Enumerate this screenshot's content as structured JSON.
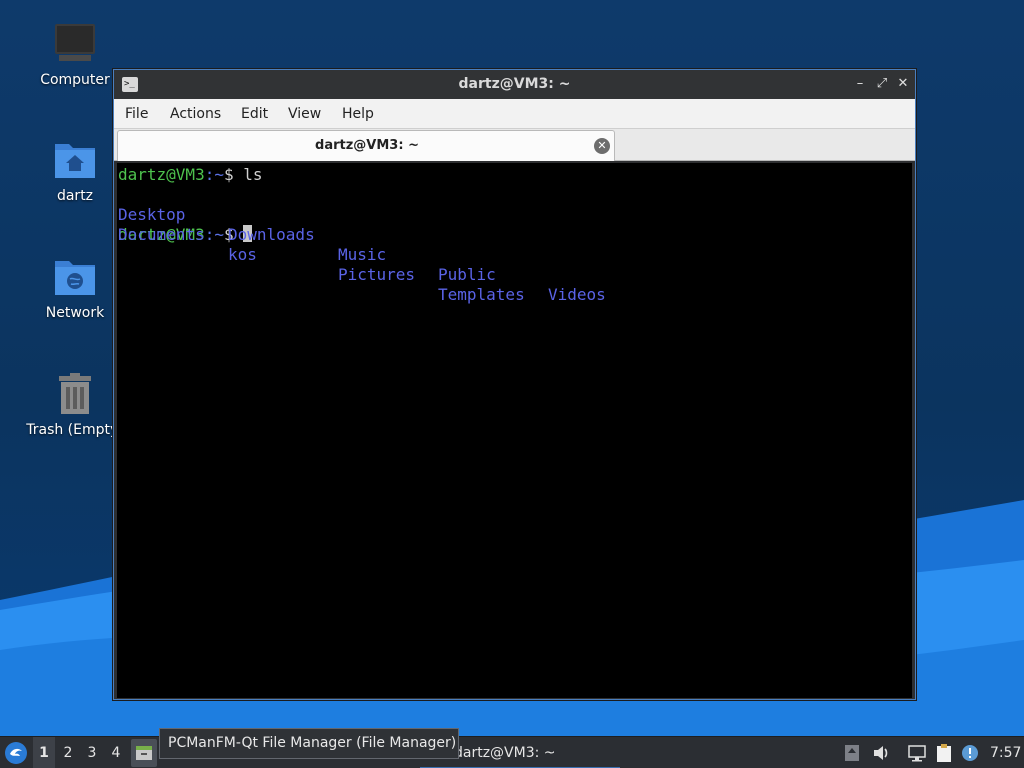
{
  "desktop": {
    "icons": [
      {
        "label": "Computer",
        "icon": "computer-icon"
      },
      {
        "label": "dartz",
        "icon": "home-folder-icon"
      },
      {
        "label": "Network",
        "icon": "network-folder-icon"
      },
      {
        "label": "Trash (Empty)",
        "icon": "trash-icon"
      }
    ]
  },
  "window": {
    "title": "dartz@VM3: ~",
    "menu": [
      "File",
      "Actions",
      "Edit",
      "View",
      "Help"
    ],
    "tab_label": "dartz@VM3: ~",
    "controls": [
      "minimize",
      "maximize",
      "close"
    ]
  },
  "terminal": {
    "prompt_user": "dartz@VM3",
    "prompt_path": ":~",
    "prompt_symbol": "$ ",
    "command": "ls",
    "ls_row1": [
      "Desktop",
      "Downloads",
      "Music",
      "Public",
      "Videos"
    ],
    "ls_row2": [
      "Documents",
      "kos",
      "Pictures",
      "Templates"
    ]
  },
  "taskbar": {
    "desktops": [
      "1",
      "2",
      "3",
      "4"
    ],
    "active_desktop": "1",
    "tooltip": "PCManFM-Qt File Manager (File Manager)",
    "task_label": "dartz@VM3: ~",
    "clock": "7:57"
  },
  "colors": {
    "prompt_user": "#4ec24e",
    "directory": "#5a63e6",
    "taskbar_bg": "#2b2e33"
  }
}
